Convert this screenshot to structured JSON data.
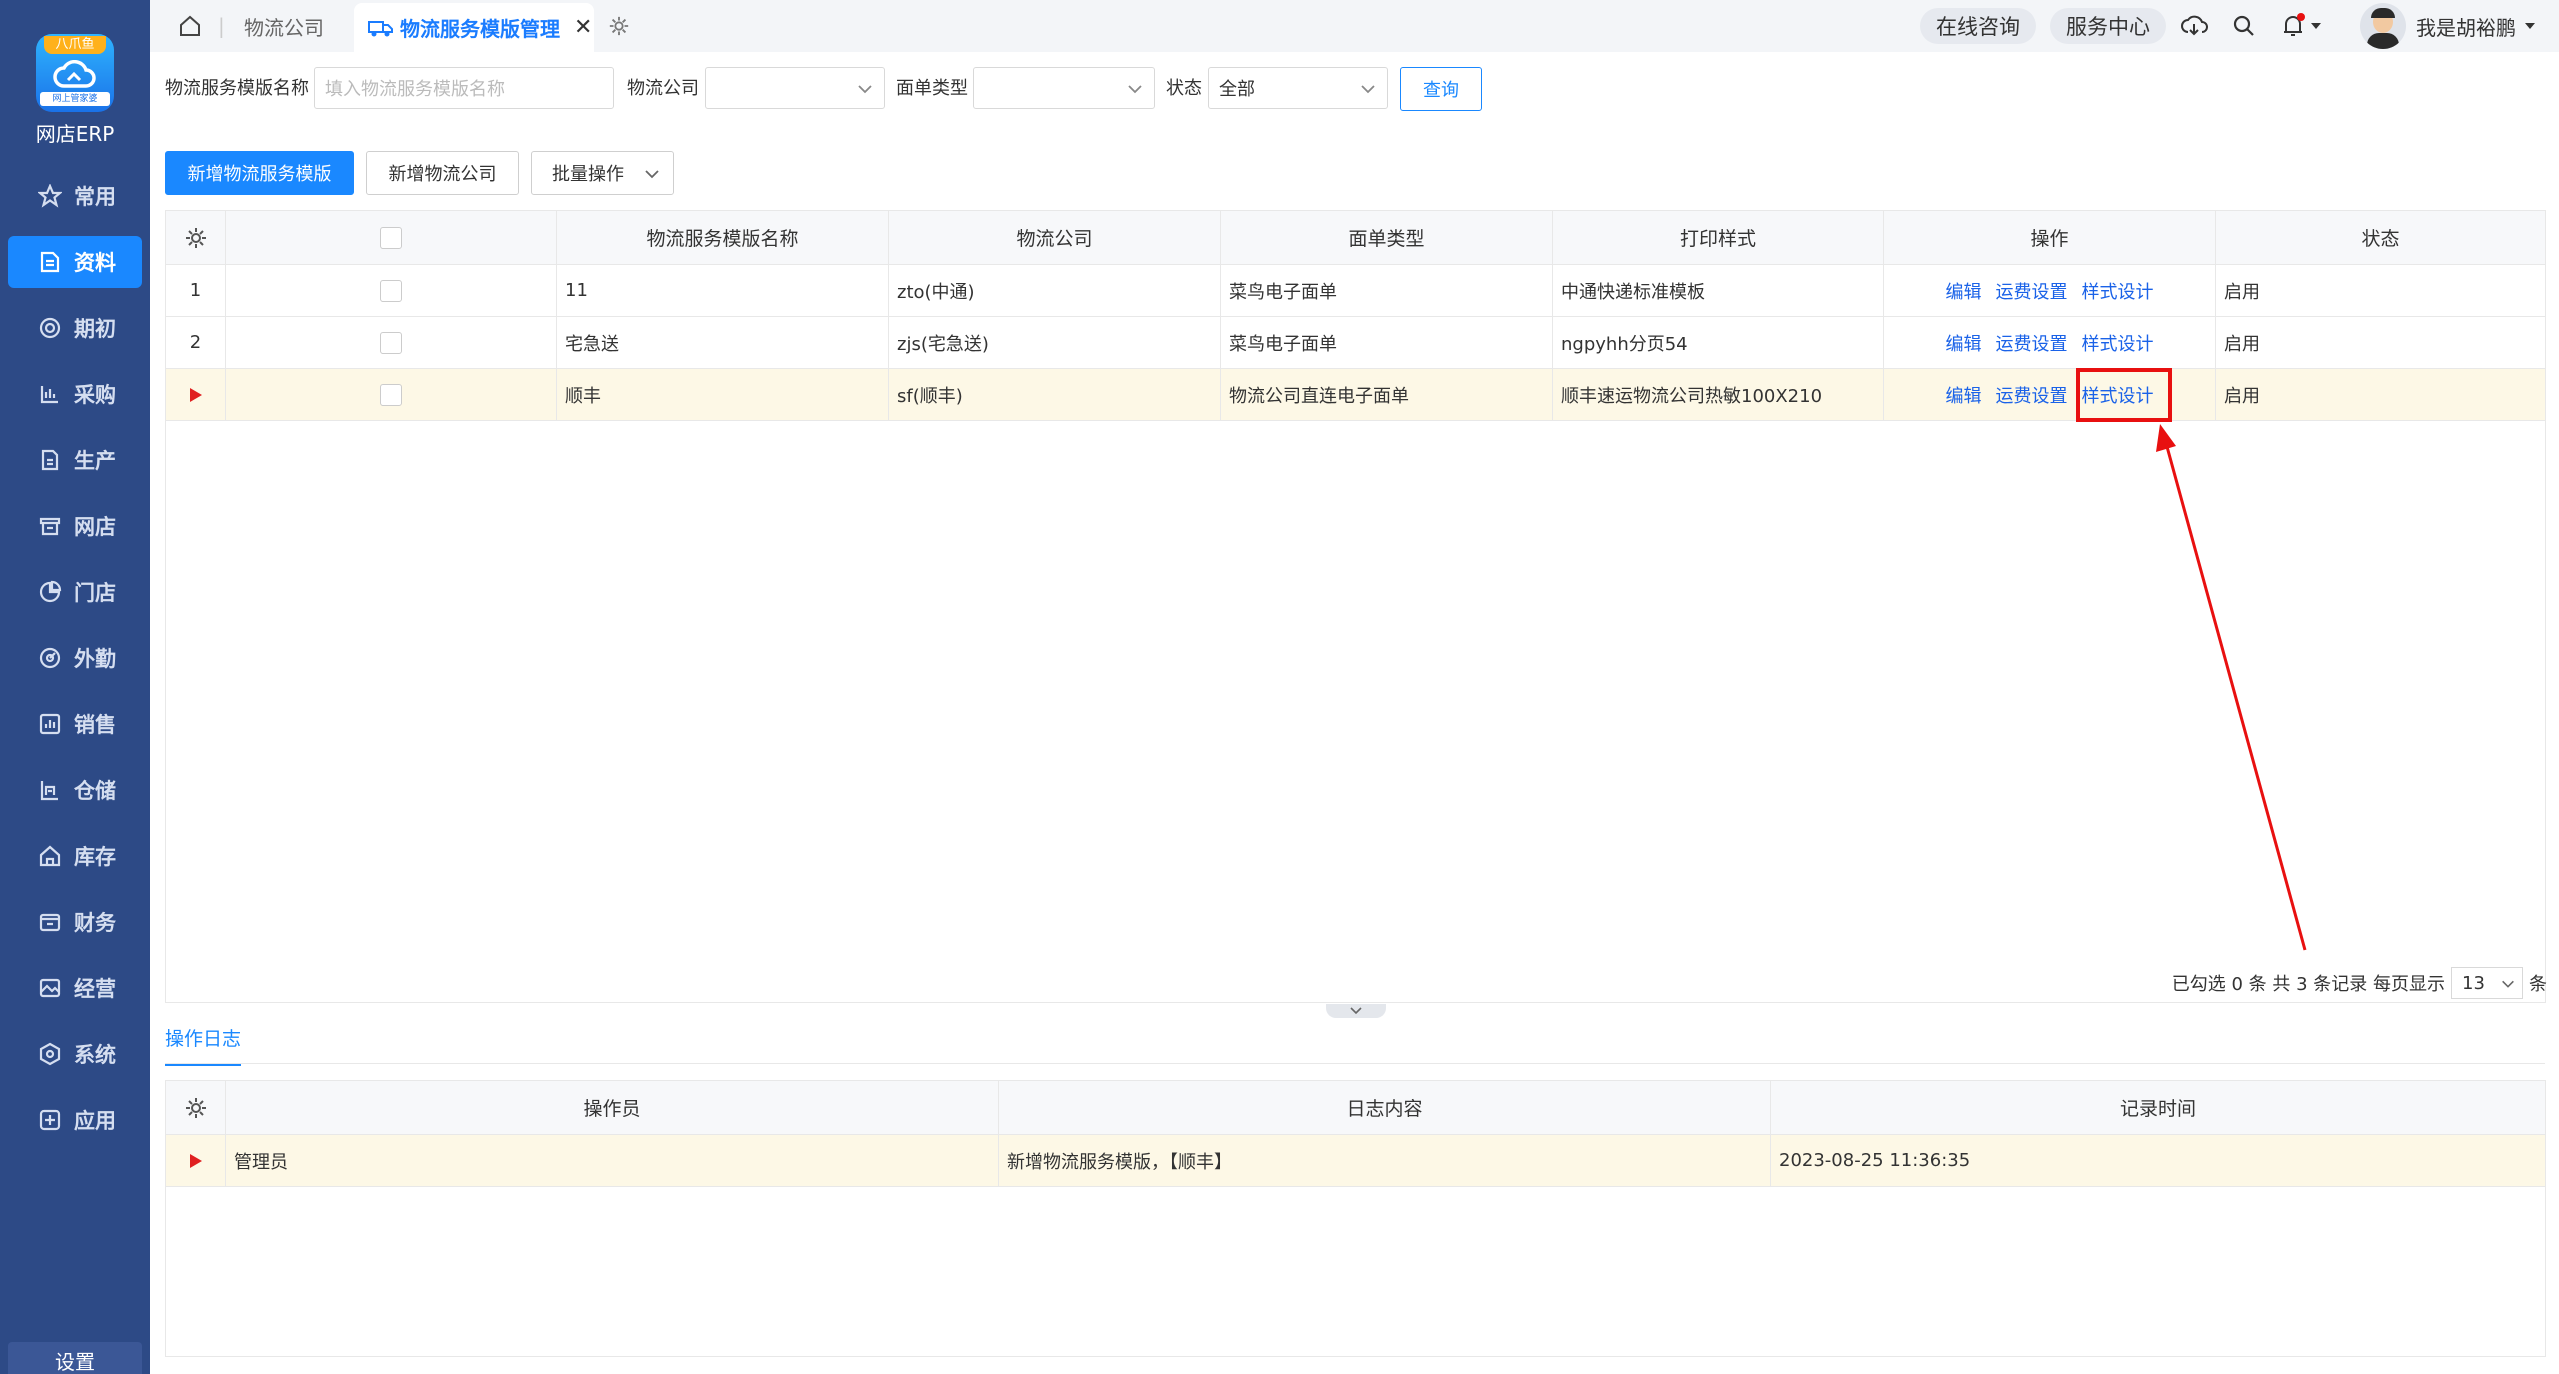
{
  "app": {
    "brand_ribbon": "八爪鱼",
    "brand_sub": "网上管家婆",
    "name": "网店ERP"
  },
  "sidebar": {
    "items": [
      {
        "label": "常用",
        "icon": "star-icon"
      },
      {
        "label": "资料",
        "icon": "document-icon",
        "active": true
      },
      {
        "label": "期初",
        "icon": "target-icon"
      },
      {
        "label": "采购",
        "icon": "cart-icon"
      },
      {
        "label": "生产",
        "icon": "factory-icon"
      },
      {
        "label": "网店",
        "icon": "store-icon"
      },
      {
        "label": "门店",
        "icon": "pie-icon"
      },
      {
        "label": "外勤",
        "icon": "gauge-icon"
      },
      {
        "label": "销售",
        "icon": "chart-icon"
      },
      {
        "label": "仓储",
        "icon": "warehouse-icon"
      },
      {
        "label": "库存",
        "icon": "home-icon"
      },
      {
        "label": "财务",
        "icon": "wallet-icon"
      },
      {
        "label": "经营",
        "icon": "image-icon"
      },
      {
        "label": "系统",
        "icon": "hexagon-icon"
      },
      {
        "label": "应用",
        "icon": "plus-box-icon"
      }
    ],
    "settings_label": "设置"
  },
  "topbar": {
    "tabs": [
      {
        "label": "物流公司"
      },
      {
        "label": "物流服务模版管理",
        "active": true
      }
    ],
    "online_consult": "在线咨询",
    "service_center": "服务中心",
    "user_name": "我是胡裕鹏"
  },
  "filter": {
    "name_label": "物流服务模版名称",
    "name_placeholder": "填入物流服务模版名称",
    "company_label": "物流公司",
    "company_value": "",
    "type_label": "面单类型",
    "type_value": "",
    "status_label": "状态",
    "status_value": "全部",
    "query_button": "查询"
  },
  "actions": {
    "add_template": "新增物流服务模版",
    "add_company": "新增物流公司",
    "batch": "批量操作"
  },
  "table": {
    "headers": [
      "物流服务模版名称",
      "物流公司",
      "面单类型",
      "打印样式",
      "操作",
      "状态"
    ],
    "rows": [
      {
        "index": "1",
        "name": "11",
        "company": "zto(中通)",
        "type": "菜鸟电子面单",
        "style": "中通快递标准模板",
        "status": "启用"
      },
      {
        "index": "2",
        "name": "宅急送",
        "company": "zjs(宅急送)",
        "type": "菜鸟电子面单",
        "style": "ngpyhh分页54",
        "status": "启用"
      },
      {
        "index": "",
        "name": "顺丰",
        "company": "sf(顺丰)",
        "type": "物流公司直连电子面单",
        "style": "顺丰速运物流公司热敏100X210",
        "status": "启用",
        "selected": true
      }
    ],
    "op_links": [
      "编辑",
      "运费设置",
      "样式设计"
    ]
  },
  "pager": {
    "summary": "已勾选 0 条 共 3 条记录 每页显示",
    "page_size": "13",
    "unit": "条"
  },
  "log": {
    "tab": "操作日志",
    "headers": [
      "操作员",
      "日志内容",
      "记录时间"
    ],
    "rows": [
      {
        "operator": "管理员",
        "content": "新增物流服务模版，【顺丰】",
        "time": "2023-08-25 11:36:35"
      }
    ]
  }
}
